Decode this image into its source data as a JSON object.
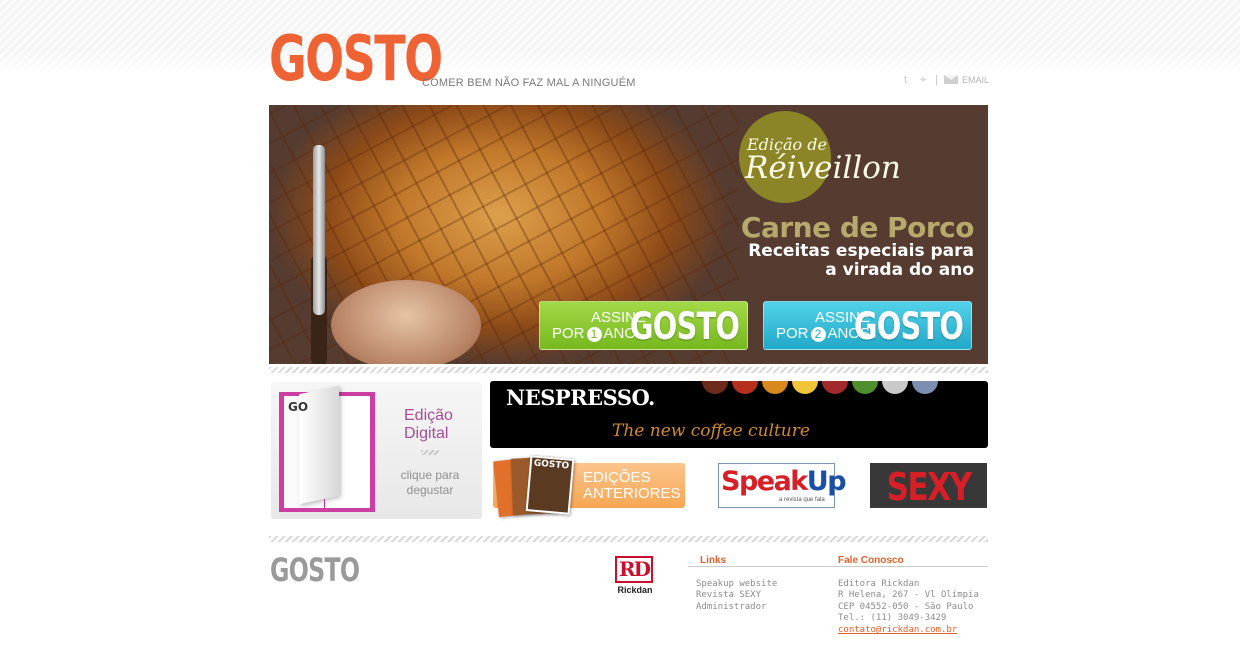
{
  "header": {
    "logo": "GOSTO",
    "tagline": "COMER BEM NÃO FAZ MAL A NINGUÉM",
    "social": {
      "email_label": "EMAIL"
    },
    "colors": {
      "brand": "#ee6234"
    }
  },
  "banner": {
    "edition_line1": "Edição de",
    "edition_line2": "Réiveillon",
    "title": "Carne de Porco",
    "subtitle_line1": "Receitas especiais para",
    "subtitle_line2": "a virada do ano",
    "buttons": [
      {
        "line1": "ASSINE",
        "line2_pre": "POR",
        "number": "1",
        "line2_post": "ANO",
        "brand": "GOSTO",
        "color": "#8cc63f"
      },
      {
        "line1": "ASSINE",
        "line2_pre": "POR",
        "number": "2",
        "line2_post": "ANOS",
        "brand": "GOSTO",
        "color": "#3bc0dd"
      }
    ]
  },
  "digital_edition": {
    "magazine_label": "GO",
    "title_line1": "Edição",
    "title_line2": "Digital",
    "cta_line1": "clique para",
    "cta_line2": "degustar"
  },
  "nespresso": {
    "logo": "NESPRESSO.",
    "slogan": "The new coffee culture"
  },
  "previous_editions": {
    "cover_label": "GOSTO",
    "label_line1": "EDIÇÕES",
    "label_line2": "ANTERIORES"
  },
  "speakup": {
    "logo_speak": "Speak",
    "logo_up": "Up",
    "sub": "a revista que fala"
  },
  "sexy": {
    "logo": "SEXY"
  },
  "footer": {
    "logo": "GOSTO",
    "publisher_logo_mark": "RD",
    "publisher_logo_name": "Rickdan",
    "links_heading": "Links",
    "links": [
      "Speakup website",
      "Revista SEXY",
      "Administrador"
    ],
    "contact_heading": "Fale Conosco",
    "contact": [
      "Editora Rickdan",
      "R Helena, 267 - Vl Olímpia",
      "CEP 04552-050 - São Paulo",
      "Tel.: (11) 3049-3429"
    ],
    "contact_email": "contato@rickdan.com.br"
  }
}
